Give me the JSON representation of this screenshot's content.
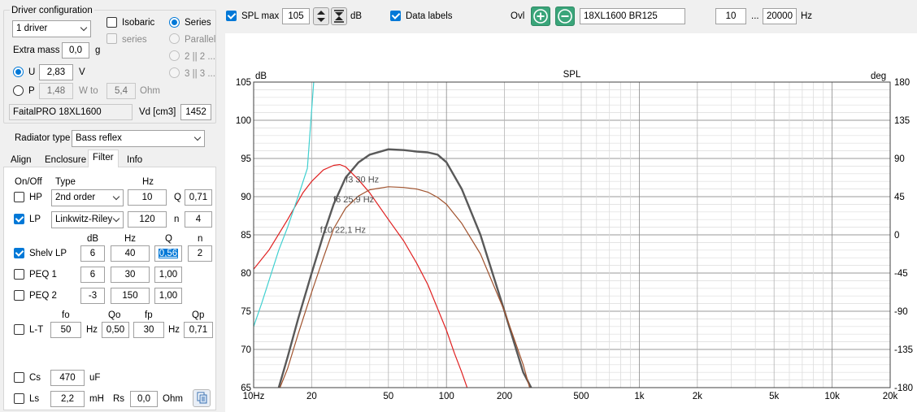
{
  "driver_config": {
    "title": "Driver configuration",
    "driver_count": "1 driver",
    "isobaric": "Isobaric",
    "series_small": "series",
    "series": "Series",
    "parallel": "Parallel",
    "two_par": "2 || 2 ...",
    "three_par": "3 || 3 ...",
    "extra_mass_label": "Extra mass",
    "extra_mass_value": "0,0",
    "extra_mass_unit": "g",
    "u_label": "U",
    "u_value": "2,83",
    "u_unit": "V",
    "p_label": "P",
    "p_value": "1,48",
    "w_to": "W to",
    "ohm_value": "5,4",
    "ohm_unit": "Ohm",
    "driver_name": "FaitalPRO 18XL1600",
    "vd_label": "Vd [cm3]",
    "vd_value": "1452"
  },
  "radiator": {
    "label": "Radiator type",
    "value": "Bass reflex"
  },
  "tabs": [
    "Align",
    "Enclosure",
    "Filter",
    "Info"
  ],
  "filter": {
    "col_onoff": "On/Off",
    "col_type": "Type",
    "col_hz": "Hz",
    "hp_label": "HP",
    "hp_type": "2nd order",
    "hp_hz": "10",
    "hp_q_label": "Q",
    "hp_q": "0,71",
    "lp_label": "LP",
    "lp_type": "Linkwitz-Riley",
    "lp_hz": "120",
    "lp_n_label": "n",
    "lp_n": "4",
    "col_db": "dB",
    "col_hz2": "Hz",
    "col_q": "Q",
    "col_n": "n",
    "shelv_label": "Shelv LP",
    "shelv_db": "6",
    "shelv_hz": "40",
    "shelv_q": "0,56",
    "shelv_n": "2",
    "peq1_label": "PEQ 1",
    "peq1_db": "6",
    "peq1_hz": "30",
    "peq1_q": "1,00",
    "peq2_label": "PEQ 2",
    "peq2_db": "-3",
    "peq2_hz": "150",
    "peq2_q": "1,00",
    "col_fo": "fo",
    "col_qo": "Qo",
    "col_fp": "fp",
    "col_qp": "Qp",
    "lt_label": "L-T",
    "lt_fo": "50",
    "lt_hz1": "Hz",
    "lt_qo": "0,50",
    "lt_fp": "30",
    "lt_hz2": "Hz",
    "lt_qp": "0,71",
    "cs_label": "Cs",
    "cs_value": "470",
    "cs_unit": "uF",
    "ls_label": "Ls",
    "ls_value": "2,2",
    "ls_unit": "mH",
    "rs_label": "Rs",
    "rs_value": "0,0",
    "rs_unit": "Ohm"
  },
  "toolbar": {
    "spl_max_label": "SPL max",
    "spl_max_value": "105",
    "db_unit": "dB",
    "data_labels": "Data labels",
    "ovl_label": "Ovl",
    "driver_field": "18XL1600 BR125",
    "freq_min": "10",
    "freq_sep": "...",
    "freq_max": "20000",
    "hz_unit": "Hz"
  },
  "colors": {
    "accent": "#0078d7",
    "ovl_button": "#3aa57a",
    "curve_total": "#595959",
    "curve_red": "#e02020",
    "curve_brown": "#a0522d",
    "curve_cyan": "#40d0d0"
  },
  "chart_data": {
    "type": "line",
    "title": "SPL",
    "ylabel_left": "dB",
    "ylabel_right": "deg",
    "x_scale": "log",
    "xlim": [
      10,
      20000
    ],
    "ylim": [
      65,
      105
    ],
    "ylim_right": [
      -180,
      180
    ],
    "grid": true,
    "x_ticks": [
      {
        "v": 10,
        "label": "10Hz"
      },
      {
        "v": 20,
        "label": "20"
      },
      {
        "v": 50,
        "label": "50"
      },
      {
        "v": 100,
        "label": "100"
      },
      {
        "v": 200,
        "label": "200"
      },
      {
        "v": 500,
        "label": "500"
      },
      {
        "v": 1000,
        "label": "1k"
      },
      {
        "v": 2000,
        "label": "2k"
      },
      {
        "v": 5000,
        "label": "5k"
      },
      {
        "v": 10000,
        "label": "10k"
      },
      {
        "v": 20000,
        "label": "20k"
      }
    ],
    "y_ticks_left": [
      "105",
      "100",
      "95",
      "90",
      "85",
      "80",
      "75",
      "70",
      "65"
    ],
    "y_ticks_right": [
      "180",
      "135",
      "90",
      "45",
      "0",
      "-45",
      "-90",
      "-135",
      "-180"
    ],
    "annotations": [
      {
        "text": "f3 30 Hz",
        "x": 30,
        "y": 92.3
      },
      {
        "text": "f6 25,9 Hz",
        "x": 25.9,
        "y": 89.7
      },
      {
        "text": "f10 22,1 Hz",
        "x": 22.1,
        "y": 85.7
      }
    ],
    "series": [
      {
        "color": "#595959",
        "width": 2.4,
        "x": [
          13.5,
          15,
          17,
          20,
          23,
          26,
          30,
          35,
          40,
          50,
          60,
          70,
          80,
          90,
          100,
          120,
          150,
          200,
          250,
          275
        ],
        "y": [
          65,
          69,
          74,
          80,
          85,
          89,
          92.5,
          94.5,
          95.5,
          96.2,
          96.1,
          95.9,
          95.8,
          95.5,
          94.5,
          91,
          85,
          75,
          67,
          65
        ]
      },
      {
        "color": "#e02020",
        "width": 1.2,
        "x": [
          10,
          12,
          15,
          18,
          20,
          23,
          26,
          28,
          30,
          35,
          40,
          50,
          60,
          70,
          80,
          100,
          110,
          120,
          128
        ],
        "y": [
          80.5,
          83,
          87,
          90.5,
          92,
          93.5,
          94.1,
          94.2,
          93.9,
          92.2,
          90.5,
          87,
          84.2,
          81.3,
          78.5,
          72.5,
          69.5,
          67,
          65
        ]
      },
      {
        "color": "#a0522d",
        "width": 1.2,
        "x": [
          13.7,
          15,
          17,
          20,
          23,
          26,
          30,
          35,
          40,
          50,
          60,
          70,
          80,
          90,
          100,
          120,
          150,
          200,
          250,
          270
        ],
        "y": [
          65,
          67.5,
          72,
          77.5,
          82,
          85.8,
          88.5,
          90.1,
          90.9,
          91.3,
          91.2,
          91,
          90.6,
          89.9,
          89,
          86.5,
          82.5,
          75,
          68,
          65
        ]
      },
      {
        "color": "#40d0d0",
        "width": 1.2,
        "x": [
          10,
          11,
          12,
          13.5,
          15,
          17,
          19,
          20.5
        ],
        "y": [
          73,
          76,
          79,
          83,
          86,
          90,
          93.7,
          105
        ]
      }
    ]
  }
}
